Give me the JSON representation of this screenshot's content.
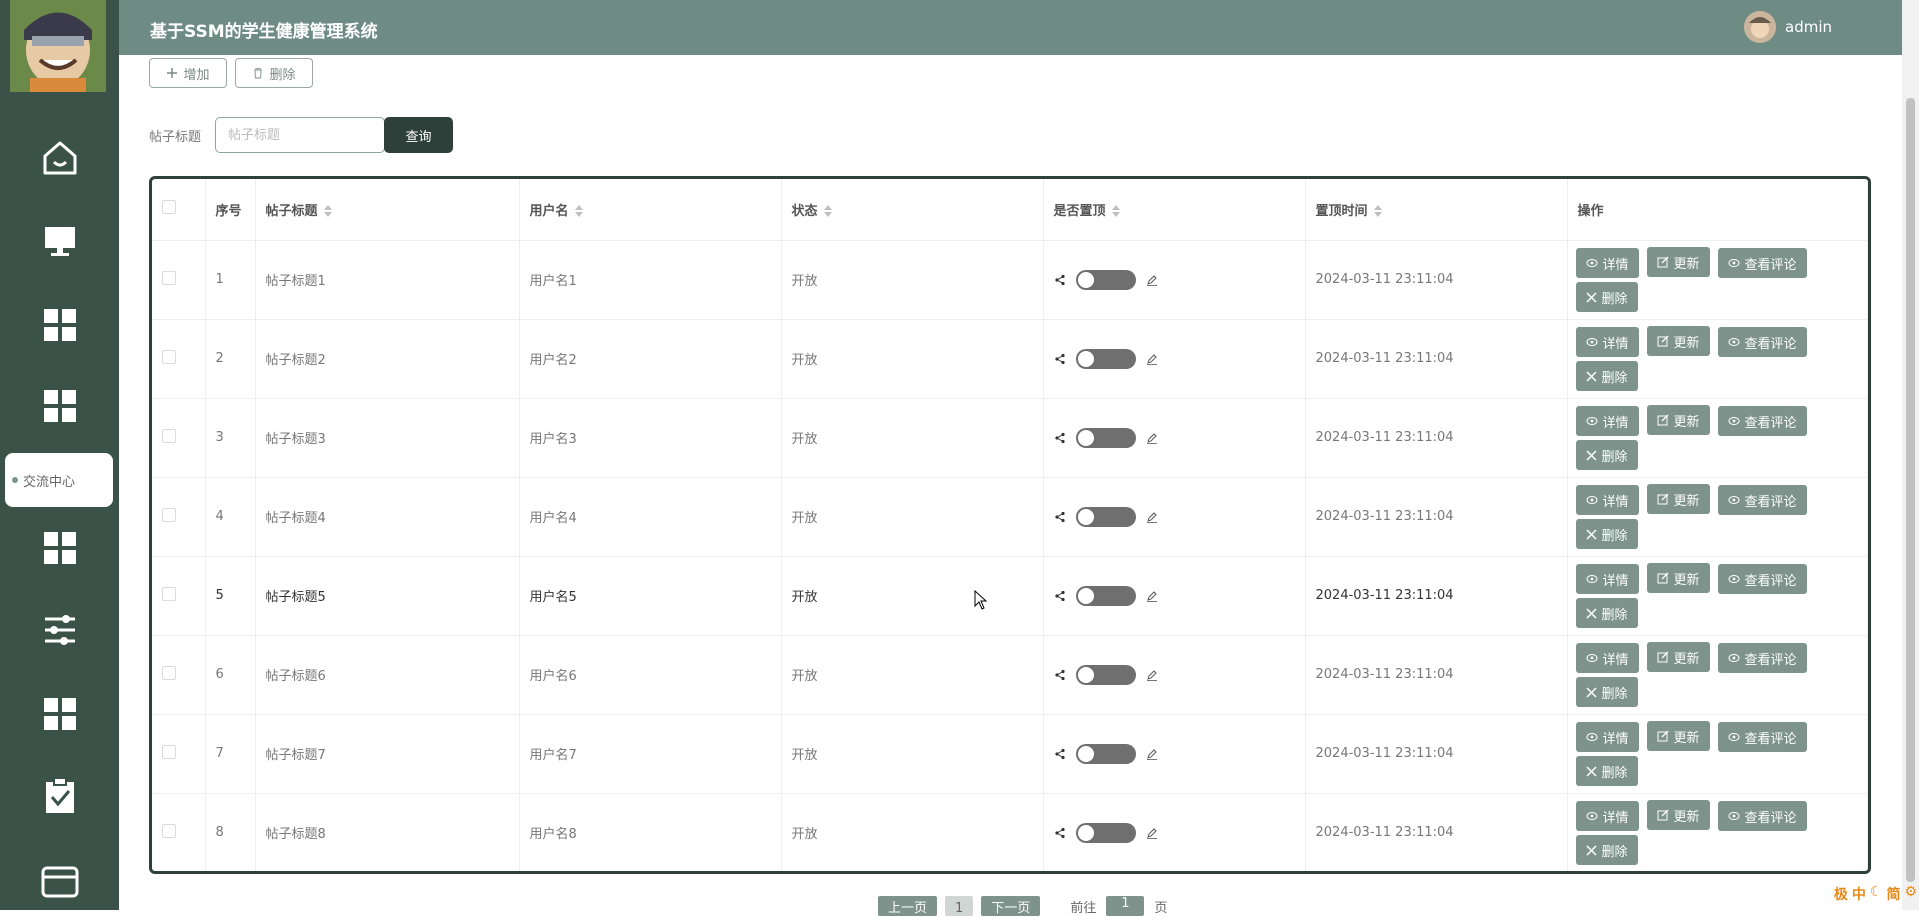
{
  "header": {
    "title": "基于SSM的学生健康管理系统",
    "username": "admin"
  },
  "sidebar": {
    "icons": [
      "home-icon",
      "monitor-icon",
      "grid-icon",
      "grid-icon",
      "grid-icon",
      "sliders-icon",
      "grid-icon",
      "clipboard-check-icon",
      "card-icon"
    ],
    "active_label": "交流中心"
  },
  "toolbar": {
    "add_label": "增加",
    "delete_label": "删除"
  },
  "search": {
    "label": "帖子标题",
    "placeholder": "帖子标题",
    "button_label": "查询"
  },
  "table": {
    "columns": [
      "序号",
      "帖子标题",
      "用户名",
      "状态",
      "是否置顶",
      "置顶时间",
      "操作"
    ],
    "rows": [
      {
        "index": "1",
        "title": "帖子标题1",
        "username": "用户名1",
        "status": "开放",
        "top_time": "2024-03-11 23:11:04"
      },
      {
        "index": "2",
        "title": "帖子标题2",
        "username": "用户名2",
        "status": "开放",
        "top_time": "2024-03-11 23:11:04"
      },
      {
        "index": "3",
        "title": "帖子标题3",
        "username": "用户名3",
        "status": "开放",
        "top_time": "2024-03-11 23:11:04"
      },
      {
        "index": "4",
        "title": "帖子标题4",
        "username": "用户名4",
        "status": "开放",
        "top_time": "2024-03-11 23:11:04"
      },
      {
        "index": "5",
        "title": "帖子标题5",
        "username": "用户名5",
        "status": "开放",
        "top_time": "2024-03-11 23:11:04"
      },
      {
        "index": "6",
        "title": "帖子标题6",
        "username": "用户名6",
        "status": "开放",
        "top_time": "2024-03-11 23:11:04"
      },
      {
        "index": "7",
        "title": "帖子标题7",
        "username": "用户名7",
        "status": "开放",
        "top_time": "2024-03-11 23:11:04"
      },
      {
        "index": "8",
        "title": "帖子标题8",
        "username": "用户名8",
        "status": "开放",
        "top_time": "2024-03-11 23:11:04"
      }
    ],
    "actions": {
      "detail": "详情",
      "update": "更新",
      "view_comments": "查看评论",
      "delete": "删除"
    }
  },
  "pagination": {
    "prev": "上一页",
    "page": "1",
    "next": "下一页",
    "goto": "前往",
    "goto_value": "1",
    "page_suffix": "页"
  },
  "tray": [
    "极",
    "中",
    "简"
  ],
  "colors": {
    "sidebar": "#3b5249",
    "header": "#6e8c83",
    "accent": "#7d938b",
    "dark": "#2e4039"
  }
}
